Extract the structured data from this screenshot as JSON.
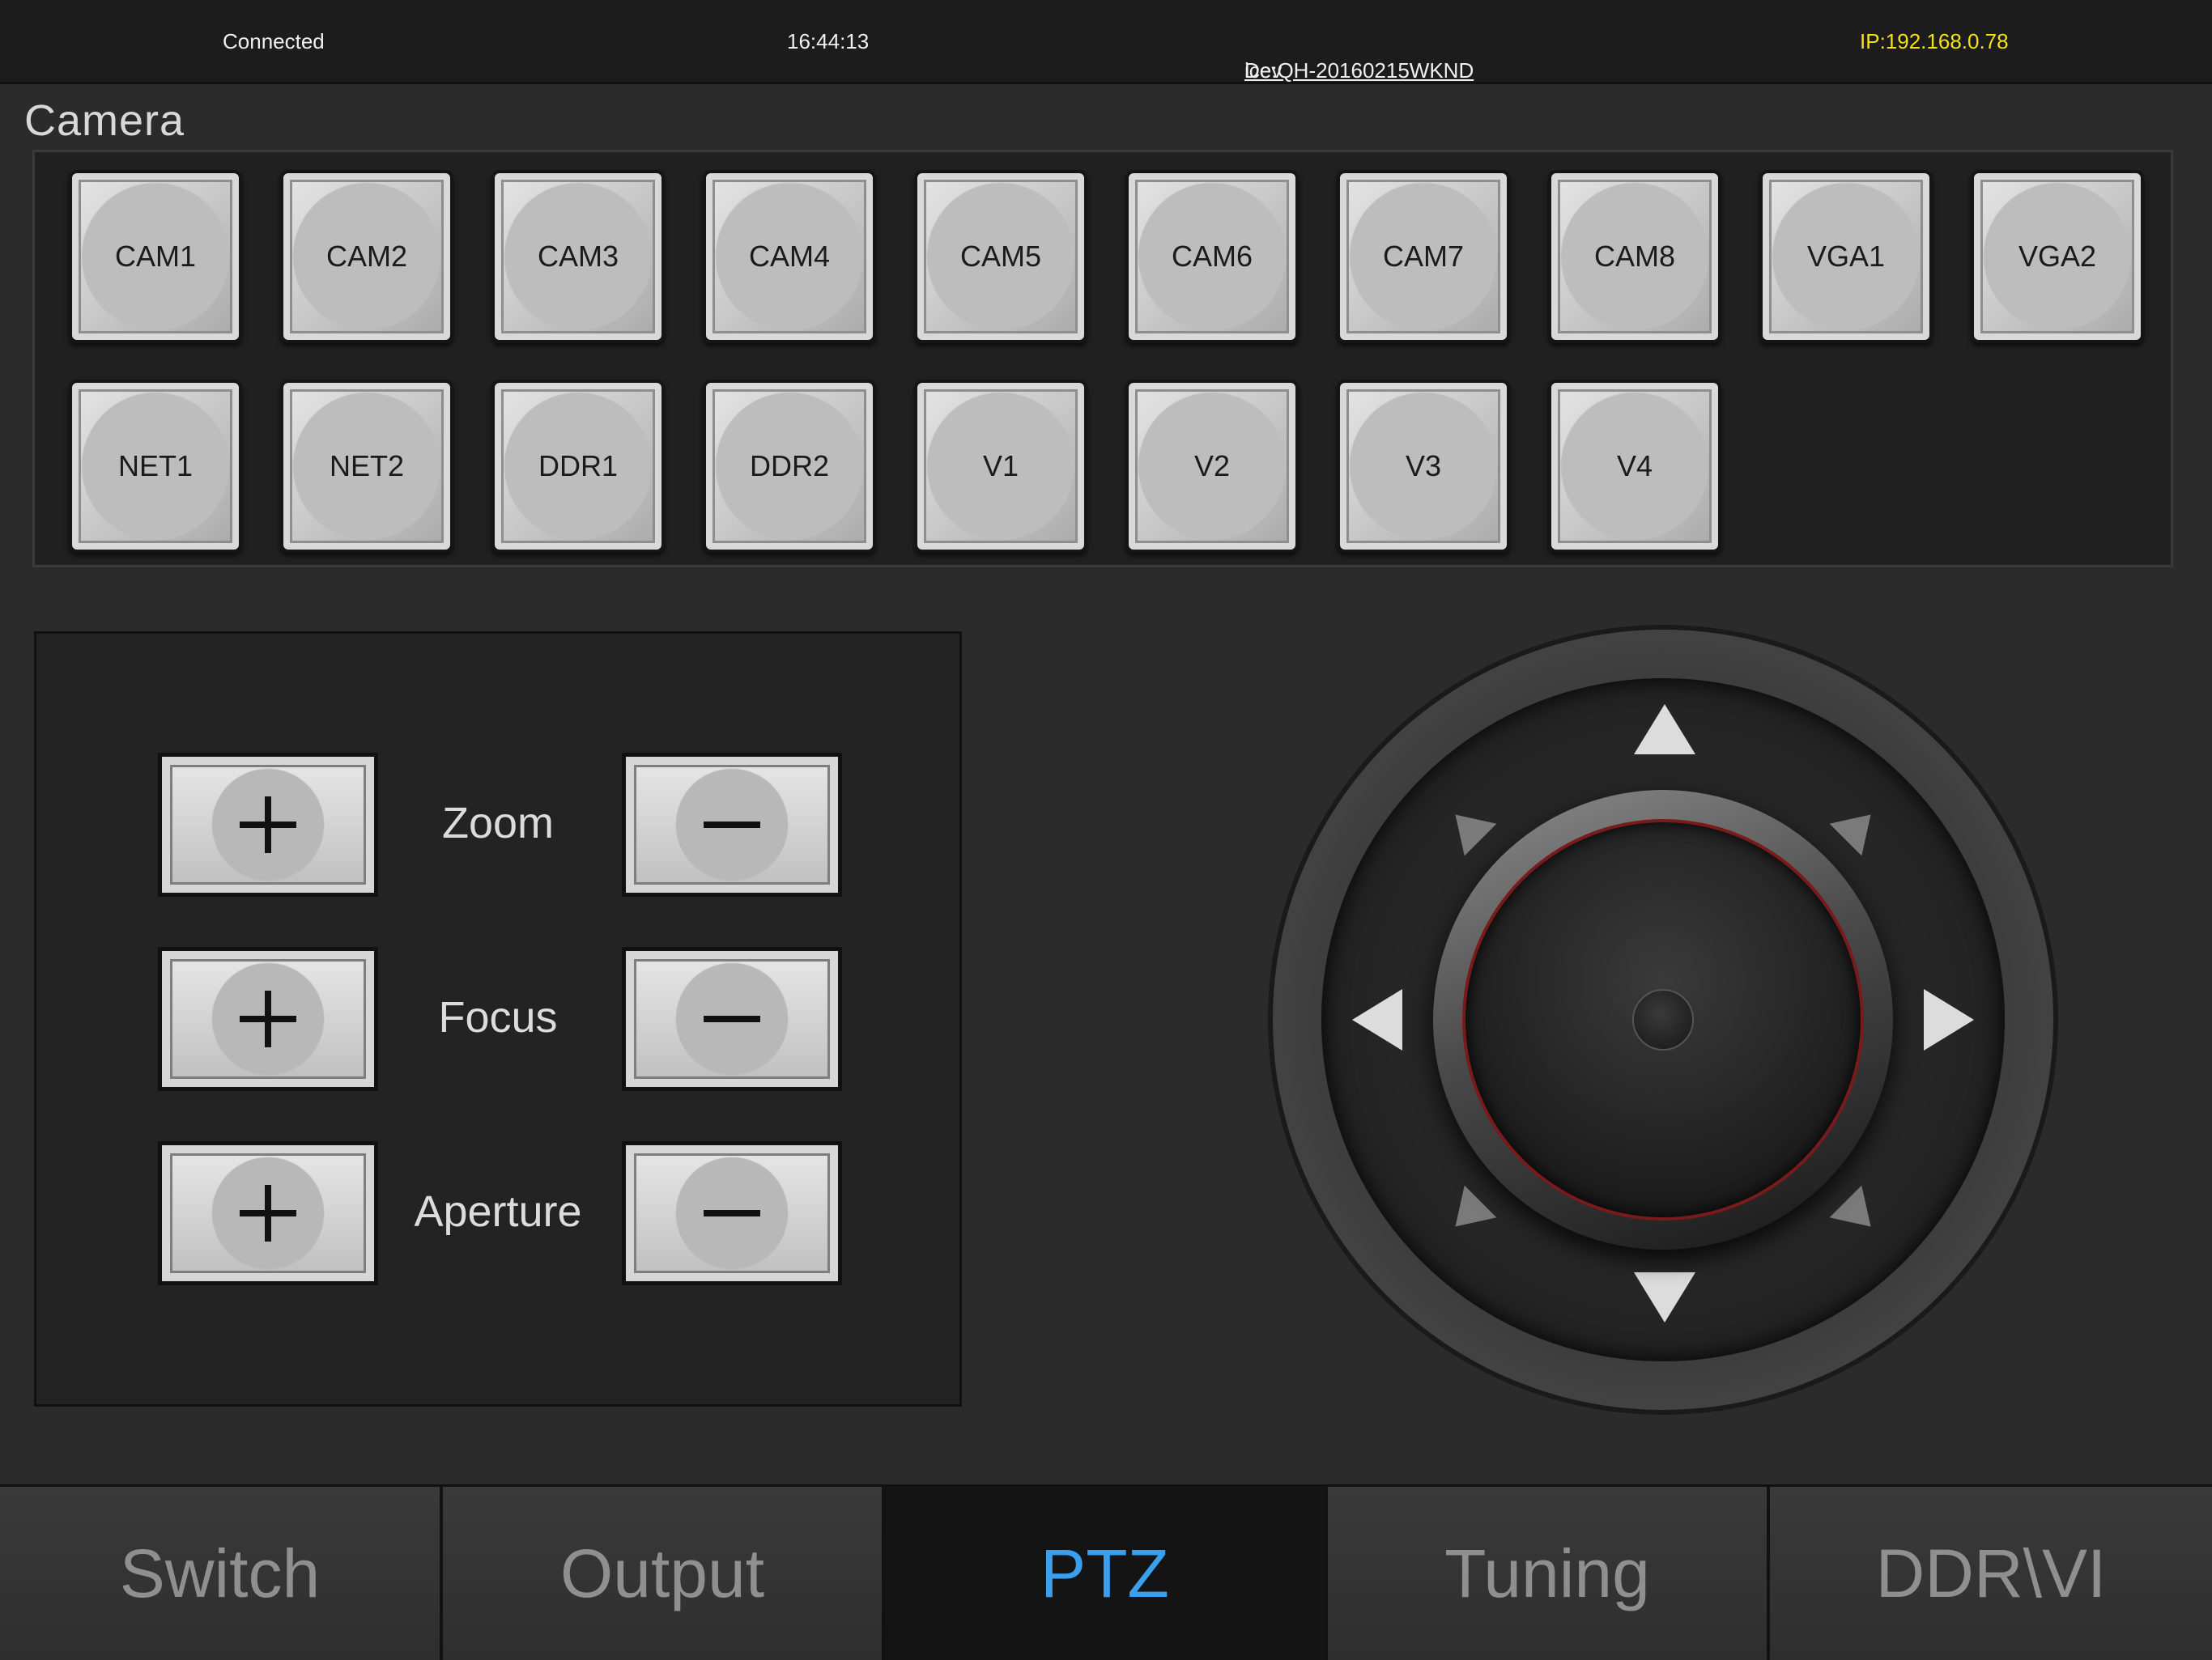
{
  "status": {
    "connection": "Connected",
    "time": "16:44:13",
    "device_prefix": "Dev",
    "device_underlined": "ice:QH-20160215WKND",
    "ip": "IP:192.168.0.78",
    "ip_color": "#f2e21b"
  },
  "camera": {
    "title": "Camera",
    "buttons": [
      "CAM1",
      "CAM2",
      "CAM3",
      "CAM4",
      "CAM5",
      "CAM6",
      "CAM7",
      "CAM8",
      "VGA1",
      "VGA2",
      "NET1",
      "NET2",
      "DDR1",
      "DDR2",
      "V1",
      "V2",
      "V3",
      "V4"
    ]
  },
  "lens": {
    "zoom_label": "Zoom",
    "focus_label": "Focus",
    "aperture_label": "Aperture"
  },
  "tabs": [
    {
      "label": "Switch",
      "active": false
    },
    {
      "label": "Output",
      "active": false
    },
    {
      "label": "PTZ",
      "active": true
    },
    {
      "label": "Tuning",
      "active": false
    },
    {
      "label": "DDR\\VI",
      "active": false
    }
  ],
  "colors": {
    "active_tab": "#3aa0ee",
    "knob_ring": "#7a1a1a"
  }
}
